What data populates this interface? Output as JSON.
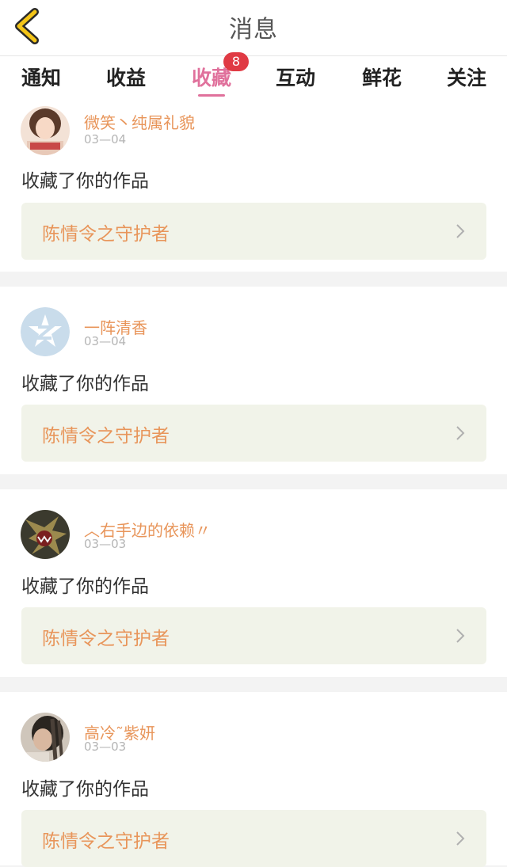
{
  "header": {
    "title": "消息"
  },
  "tabs": [
    {
      "label": "通知"
    },
    {
      "label": "收益"
    },
    {
      "label": "收藏",
      "badge": "8",
      "active": true
    },
    {
      "label": "互动"
    },
    {
      "label": "鲜花"
    },
    {
      "label": "关注"
    }
  ],
  "messages": [
    {
      "user": "微笑丶纯属礼貌",
      "date": "03—04",
      "action": "收藏了你的作品",
      "work": "陈情令之守护者"
    },
    {
      "user": "一阵清香",
      "date": "03—04",
      "action": "收藏了你的作品",
      "work": "陈情令之守护者"
    },
    {
      "user": "︿右手边的依赖〃",
      "date": "03—03",
      "action": "收藏了你的作品",
      "work": "陈情令之守护者"
    },
    {
      "user": "高冷˜紫妍",
      "date": "03—03",
      "action": "收藏了你的作品",
      "work": "陈情令之守护者"
    }
  ],
  "colors": {
    "accent": "#e0719c",
    "badge": "#e03a44",
    "username": "#e8955a",
    "work_bg": "#f1f3e9"
  }
}
